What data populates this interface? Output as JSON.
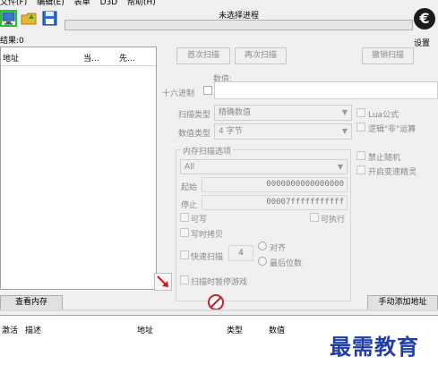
{
  "menu": [
    "文件(F)",
    "编辑(E)",
    "表单",
    "D3D",
    "帮助(H)"
  ],
  "process": {
    "title": "未选择进程"
  },
  "settings_label": "设置",
  "found_label": "结果:0",
  "results_columns": [
    "地址",
    "当...",
    "先..."
  ],
  "buttons": {
    "first_scan": "首次扫描",
    "next_scan": "再次扫描",
    "undo_scan": "撤销扫描",
    "memory_view": "查看内存",
    "add_address": "手动添加地址"
  },
  "value_label": "数值:",
  "hex_label": "十六进制",
  "scan_type": {
    "label": "扫描类型",
    "value": "精确数值"
  },
  "value_type": {
    "label": "数值类型",
    "value": "4 字节"
  },
  "lua_label": "Lua公式",
  "not_logic_label": "逻辑\"非\"运算",
  "mem_options": {
    "title": "内存扫描选项",
    "region": "All",
    "start_label": "起始",
    "start_value": "0000000000000000",
    "stop_label": "停止",
    "stop_value": "00007fffffffffff",
    "writable": "可写",
    "executable": "可执行",
    "copy_on_write": "写时拷贝",
    "fast_scan": "快速扫描",
    "fast_scan_value": "4",
    "align": "对齐",
    "last_digits": "最后位数",
    "pause_game": "扫描时暂停游戏"
  },
  "no_random": "禁止随机",
  "speedhack": "开启变速精灵",
  "list_columns": [
    "激活",
    "描述",
    "地址",
    "类型",
    "数值"
  ],
  "watermark": "最需教育",
  "icons": {
    "open_process": "computer-icon",
    "open_file": "folder-icon",
    "save": "floppy-disk-icon",
    "logo": "cheat-engine-logo-icon",
    "arrow": "red-arrow-icon",
    "clear": "no-entry-icon"
  }
}
